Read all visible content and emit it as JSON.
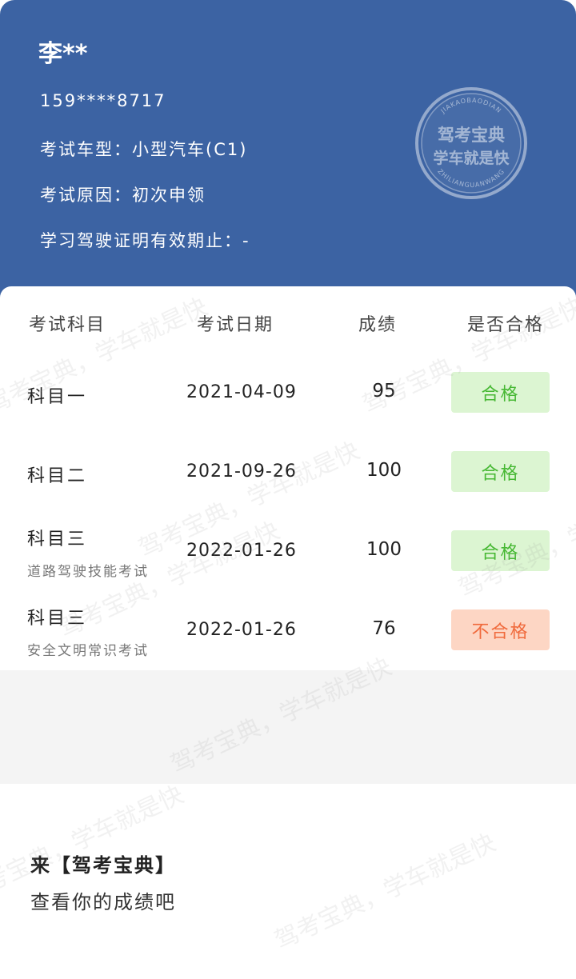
{
  "profile": {
    "name": "李**",
    "phone": "159****8717",
    "car_type": "考试车型：小型汽车(C1)",
    "exam_reason": "考试原因：初次申领",
    "validity": "学习驾驶证明有效期止：-"
  },
  "stamp": {
    "top_arc": "JIAKAOBAODIAN",
    "line1": "驾考宝典",
    "line2": "学车就是快",
    "bottom_arc": "ZHILIANGUANWANG"
  },
  "table": {
    "headers": {
      "subject": "考试科目",
      "date": "考试日期",
      "score": "成绩",
      "pass": "是否合格"
    },
    "rows": [
      {
        "subject": "科目一",
        "note": "",
        "date": "2021-04-09",
        "score": "95",
        "status": "合格",
        "passed": true
      },
      {
        "subject": "科目二",
        "note": "",
        "date": "2021-09-26",
        "score": "100",
        "status": "合格",
        "passed": true
      },
      {
        "subject": "科目三",
        "note": "道路驾驶技能考试",
        "date": "2022-01-26",
        "score": "100",
        "status": "合格",
        "passed": true
      },
      {
        "subject": "科目三",
        "note": "安全文明常识考试",
        "date": "2022-01-26",
        "score": "76",
        "status": "不合格",
        "passed": false
      }
    ]
  },
  "promo": {
    "line1": "来【驾考宝典】",
    "line2": "查看你的成绩吧"
  },
  "watermark": "驾考宝典，学车就是快",
  "colors": {
    "header_bg": "#3c63a3",
    "pass_bg": "#dcf5d2",
    "pass_text": "#47b834",
    "fail_bg": "#fdd6c4",
    "fail_text": "#f06a3c"
  }
}
